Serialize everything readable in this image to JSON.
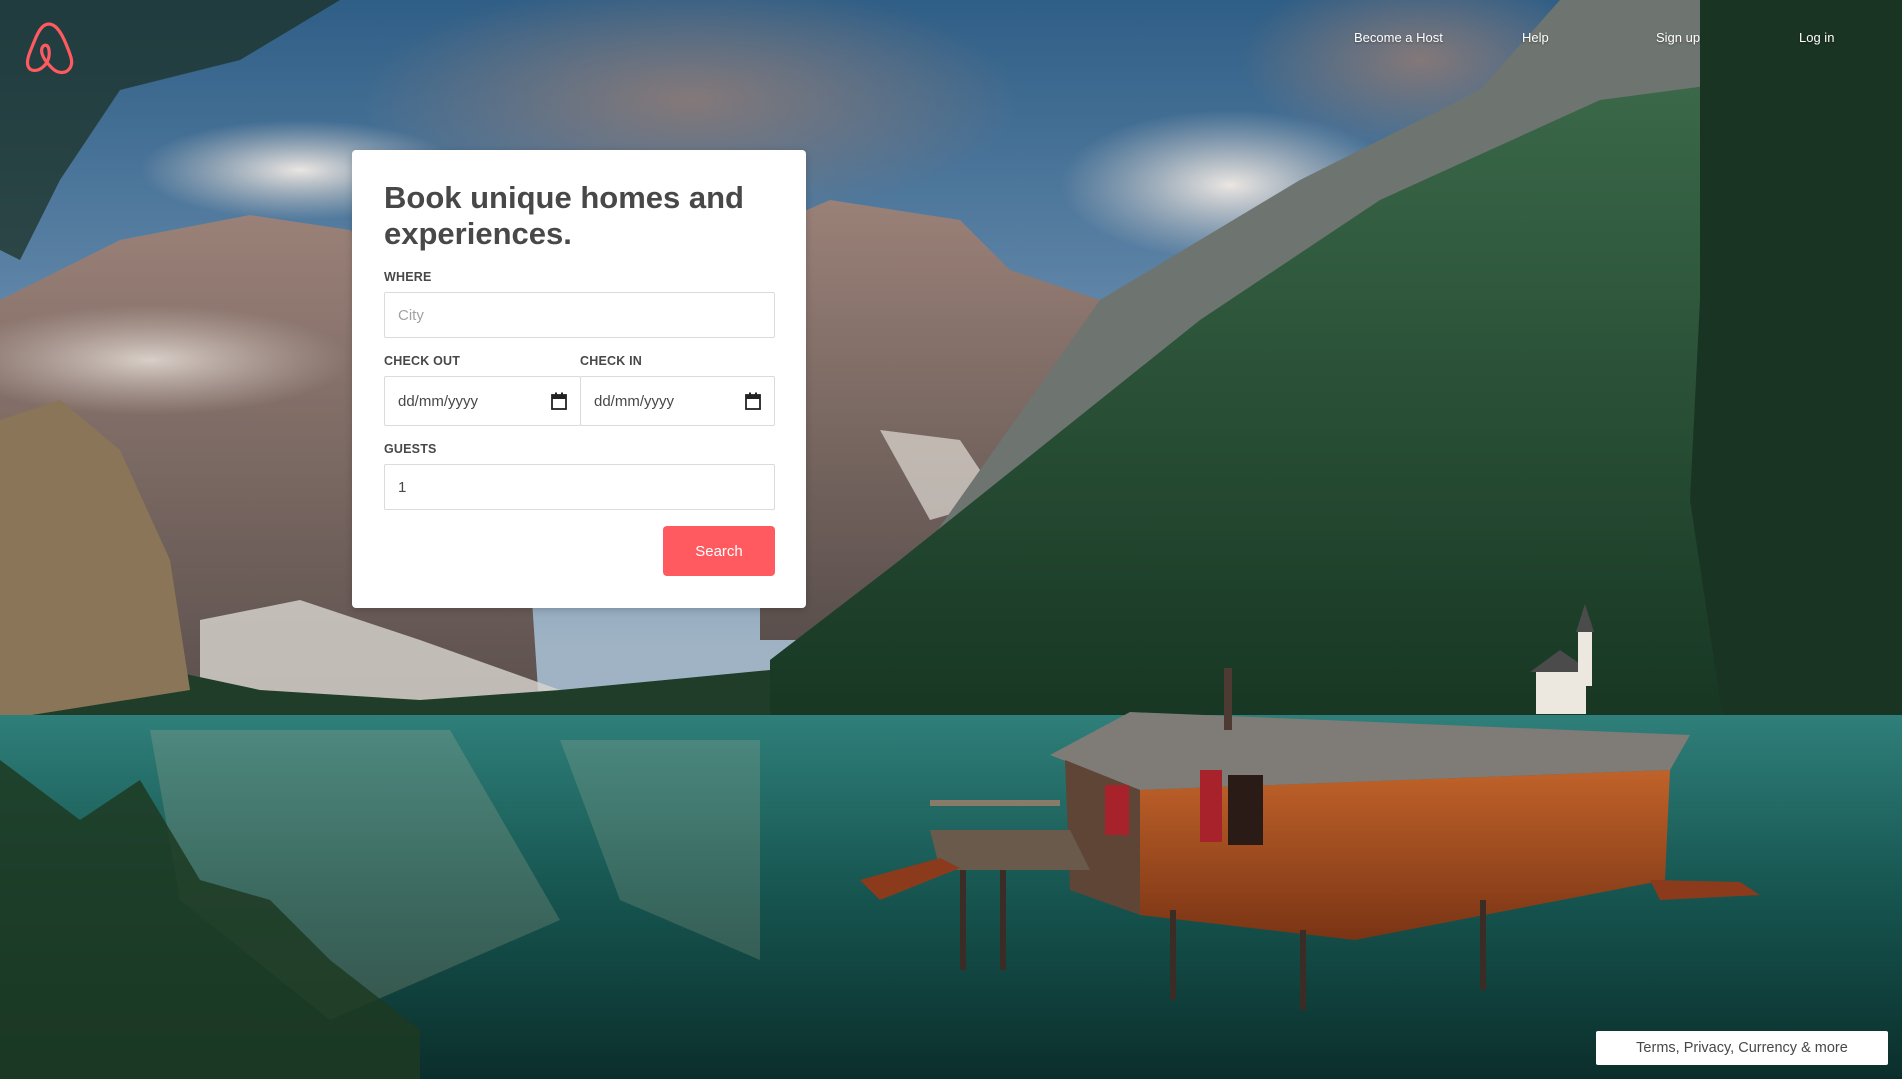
{
  "nav": {
    "logo": "airbnb-logo",
    "become_host": "Become a Host",
    "help": "Help",
    "sign_up": "Sign up",
    "log_in": "Log in"
  },
  "booking": {
    "title": "Book unique homes and experiences.",
    "where": {
      "label": "WHERE",
      "placeholder": "City",
      "value": ""
    },
    "check_out": {
      "label": "CHECK OUT",
      "value": "dd/mm/yyyy",
      "icon": "calendar-icon"
    },
    "check_in": {
      "label": "CHECK IN",
      "value": "dd/mm/yyyy",
      "icon": "calendar-icon"
    },
    "guests": {
      "label": "GUESTS",
      "value": "1"
    },
    "search_label": "Search"
  },
  "footer": {
    "links_label": "Terms, Privacy, Currency & more"
  },
  "colors": {
    "brand": "#ff5a5f",
    "text": "#484848",
    "border": "#dbdbdb"
  }
}
